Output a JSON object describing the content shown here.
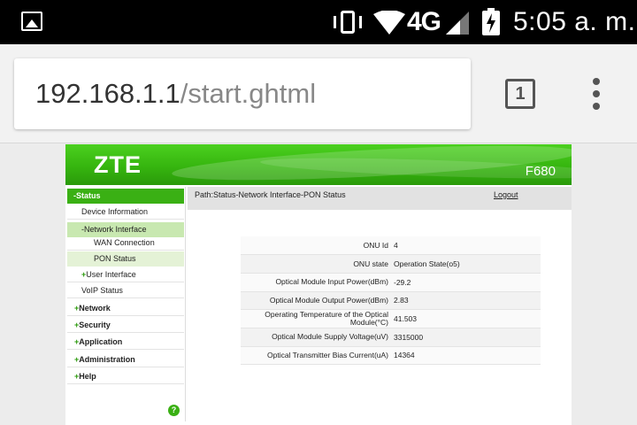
{
  "status_bar": {
    "time": "5:05 a. m.",
    "network": "4G",
    "icons": [
      "image-notification-icon",
      "vibrate-icon",
      "wifi-icon",
      "cell-signal-icon",
      "battery-charging-icon"
    ]
  },
  "browser": {
    "url_host": "192.168.1.1",
    "url_path": "/start.ghtml",
    "tab_count": "1"
  },
  "banner": {
    "logo": "ZTE",
    "model": "F680"
  },
  "sidebar": {
    "status": "-Status",
    "device_information": "Device Information",
    "network_interface": "-Network Interface",
    "wan_connection": "WAN Connection",
    "pon_status": "PON Status",
    "user_interface": "User Interface",
    "voip_status": "VoIP Status",
    "network": "Network",
    "security": "Security",
    "application": "Application",
    "administration": "Administration",
    "help": "Help",
    "plus": "+",
    "help_glyph": "?"
  },
  "path": {
    "text": "Path:Status-Network Interface-PON Status",
    "logout": "Logout"
  },
  "pon_table": {
    "rows": [
      {
        "label": "ONU Id",
        "value": "4"
      },
      {
        "label": "ONU state",
        "value": "Operation State(o5)"
      },
      {
        "label": "Optical Module Input Power(dBm)",
        "value": "-29.2"
      },
      {
        "label": "Optical Module Output Power(dBm)",
        "value": "2.83"
      },
      {
        "label": "Operating Temperature of the Optical Module(°C)",
        "value": "41.503"
      },
      {
        "label": "Optical Module Supply Voltage(uV)",
        "value": "3315000"
      },
      {
        "label": "Optical Transmitter Bias Current(uA)",
        "value": "14364"
      }
    ]
  },
  "colors": {
    "brand_green": "#3ab014",
    "selected_light": "#c8e8b0"
  }
}
